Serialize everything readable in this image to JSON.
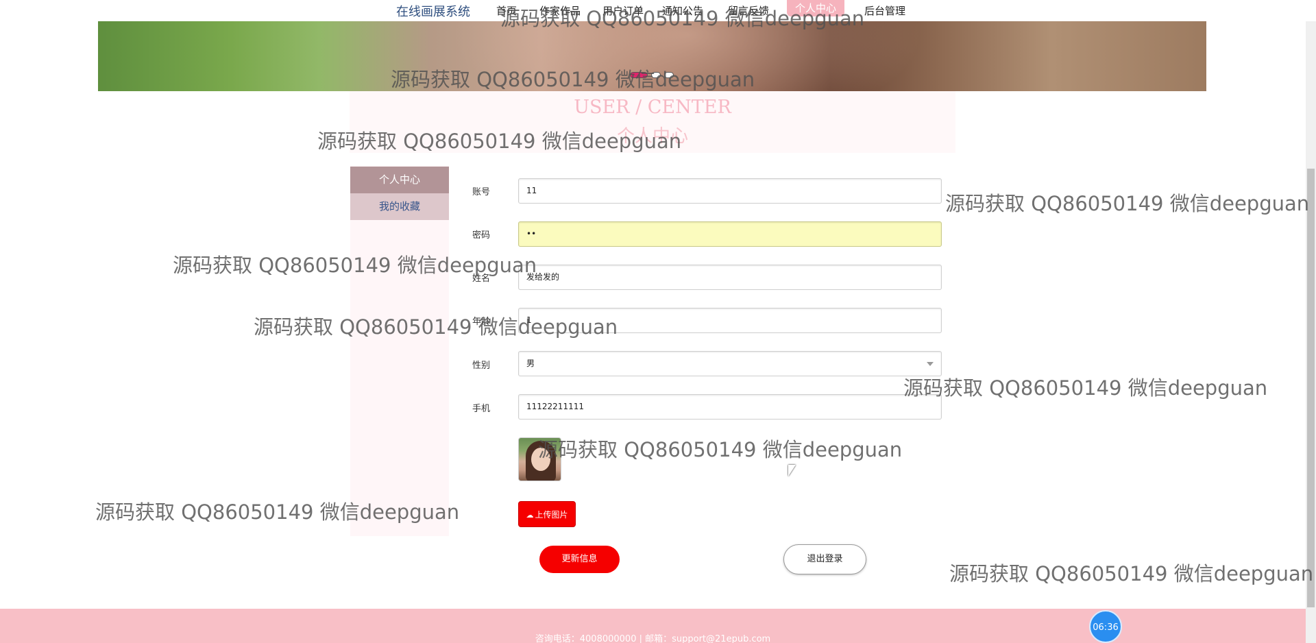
{
  "nav": {
    "brand": "在线画展系统",
    "items": [
      {
        "label": "首页"
      },
      {
        "label": "作家作品"
      },
      {
        "label": "用户订单"
      },
      {
        "label": "通知公告"
      },
      {
        "label": "留言反馈"
      },
      {
        "label": "个人中心"
      },
      {
        "label": "后台管理"
      }
    ]
  },
  "page_title": {
    "en": "USER / CENTER",
    "cn": "个人中心"
  },
  "sidebar": {
    "items": [
      {
        "label": "个人中心"
      },
      {
        "label": "我的收藏"
      }
    ]
  },
  "form": {
    "account": {
      "label": "账号",
      "value": "11"
    },
    "password": {
      "label": "密码",
      "value": "••"
    },
    "name": {
      "label": "姓名",
      "value": "发给发的"
    },
    "age": {
      "label": "年龄",
      "value": "1"
    },
    "gender": {
      "label": "性别",
      "value": "男"
    },
    "phone": {
      "label": "手机",
      "value": "11122211111"
    },
    "upload_label": "上传图片",
    "update_label": "更新信息",
    "logout_label": "退出登录"
  },
  "footer": {
    "text": "咨询电话：4008000000 | 邮箱：support@21epub.com"
  },
  "clock": "06:36",
  "watermark": "源码获取 QQ86050149 微信deepguan",
  "colors": {
    "accent_red": "#f50000",
    "footer_pink": "#f8bfc6",
    "sidebar_active": "#b29497"
  }
}
